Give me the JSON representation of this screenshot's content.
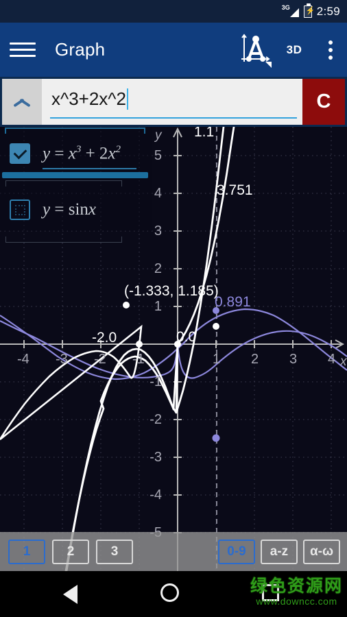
{
  "status_bar": {
    "network_label": "3G",
    "battery_icon": "battery-charging-icon",
    "clock": "2:59"
  },
  "app_bar": {
    "menu_icon": "hamburger-menu-icon",
    "title": "Graph",
    "graph_axes_icon": "graph-axes-icon",
    "mode_3d_label": "3D",
    "overflow_icon": "overflow-menu-icon"
  },
  "input_bar": {
    "collapse_icon": "chevron-up-icon",
    "expression": "x^3+2x^2",
    "placeholder": "",
    "clear_label": "C",
    "clear_color": "#8d0c0c"
  },
  "function_panel": {
    "rows": [
      {
        "checked": true,
        "label": "y = x3 + 2x2",
        "base": "y = x",
        "exp1": "3",
        "mid": " + 2x",
        "exp2": "2"
      },
      {
        "checked": false,
        "label": "y = sin x",
        "base": "y = sin x",
        "exp1": "",
        "mid": "",
        "exp2": ""
      }
    ]
  },
  "graph": {
    "background_color": "#0a0a18",
    "axis_label_x": "x",
    "axis_label_y": "y",
    "x_ticks": [
      "-4",
      "-3",
      "-2",
      "-1",
      "1",
      "2",
      "3",
      "4"
    ],
    "y_ticks_positive": [
      "1",
      "2",
      "3",
      "4",
      "5"
    ],
    "y_ticks_negative": [
      "-1",
      "-2",
      "-3",
      "-4",
      "-5"
    ],
    "point_labels": [
      {
        "text": "1.1",
        "name": "top-value-label"
      },
      {
        "text": "3.751",
        "name": "intersection-y-label"
      },
      {
        "text": "(-1.333, 1.185)",
        "name": "local-max-label"
      },
      {
        "text": "0.891",
        "name": "sine-value-label"
      },
      {
        "text": "-2.0",
        "name": "root-left-label"
      },
      {
        "text": "0.0",
        "name": "root-origin-label"
      }
    ],
    "curve_colors": {
      "cubic": "#ffffff",
      "sine": "#8d88dd"
    }
  },
  "chart_data": {
    "type": "line",
    "title": "",
    "xlabel": "x",
    "ylabel": "y",
    "xlim": [
      -4.6,
      4.6
    ],
    "ylim": [
      -5.4,
      5.6
    ],
    "grid": true,
    "legend": "none",
    "series": [
      {
        "name": "y = x^3 + 2x^2",
        "color": "#ffffff",
        "annotations": [
          {
            "x": -2.0,
            "y": 0.0,
            "label": "-2.0"
          },
          {
            "x": -1.333,
            "y": 1.185,
            "label": "(-1.333, 1.185)"
          },
          {
            "x": 0.0,
            "y": 0.0,
            "label": "0.0"
          },
          {
            "x": 1.1,
            "y": 3.751,
            "label": "3.751"
          }
        ]
      },
      {
        "name": "y = sin x",
        "color": "#8d88dd",
        "annotations": [
          {
            "x": 1.1,
            "y": 0.891,
            "label": "0.891"
          }
        ]
      }
    ],
    "cursor_x": 1.1,
    "cursor_label": "1.1"
  },
  "keyboard_bar": {
    "left_keys": [
      {
        "label": "1",
        "active": true
      },
      {
        "label": "2",
        "active": false
      },
      {
        "label": "3",
        "active": false
      }
    ],
    "right_keys": [
      {
        "label": "0-9",
        "active": true
      },
      {
        "label": "a-z",
        "active": false
      },
      {
        "label": "α-ω",
        "active": false
      }
    ]
  },
  "nav_bar": {
    "back_icon": "back-triangle-icon",
    "home_icon": "home-circle-icon",
    "recents_icon": "recents-square-icon",
    "watermark_cn": "绿色资源网",
    "watermark_url": "www.downcc.com"
  }
}
